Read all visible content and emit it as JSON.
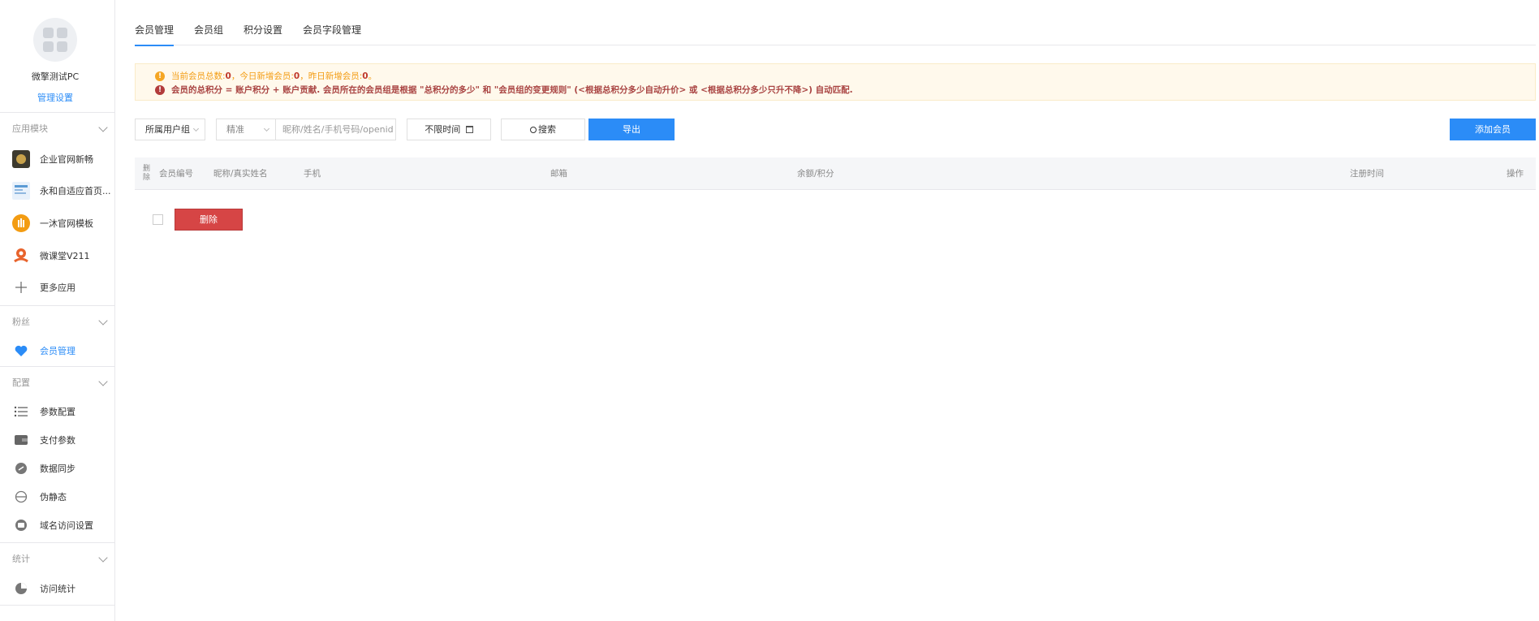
{
  "sidebar": {
    "app_name": "微擎测试PC",
    "manage_link": "管理设置",
    "groups": [
      {
        "title": "应用模块"
      },
      {
        "title": "粉丝"
      },
      {
        "title": "配置"
      },
      {
        "title": "统计"
      }
    ],
    "apps": [
      {
        "label": "企业官网新畅",
        "icon": "app-thumbnail-icon"
      },
      {
        "label": "永和自适应首页...",
        "icon": "app-thumbnail-icon"
      },
      {
        "label": "一沐官网模板",
        "icon": "app-thumbnail-icon"
      },
      {
        "label": "微课堂V211",
        "icon": "app-thumbnail-icon"
      },
      {
        "label": "更多应用",
        "icon": "plus-icon"
      }
    ],
    "fans": [
      {
        "label": "会员管理",
        "icon": "heart-icon",
        "active": true
      }
    ],
    "config": [
      {
        "label": "参数配置",
        "icon": "list-icon"
      },
      {
        "label": "支付参数",
        "icon": "wallet-icon"
      },
      {
        "label": "数据同步",
        "icon": "sync-icon"
      },
      {
        "label": "伪静态",
        "icon": "static-icon"
      },
      {
        "label": "域名访问设置",
        "icon": "domain-icon"
      }
    ],
    "stats": [
      {
        "label": "访问统计",
        "icon": "chart-icon"
      }
    ]
  },
  "tabs": [
    {
      "label": "会员管理",
      "active": true
    },
    {
      "label": "会员组",
      "active": false
    },
    {
      "label": "积分设置",
      "active": false
    },
    {
      "label": "会员字段管理",
      "active": false
    }
  ],
  "notice": {
    "line1_a": "当前会员总数:",
    "total": "0",
    "line1_b": "，今日新增会员:",
    "today": "0",
    "line1_c": "，昨日新增会员:",
    "yesterday": "0",
    "line1_d": "。",
    "line2": "会员的总积分 = 账户积分 + 账户贡献. 会员所在的会员组是根据 \"总积分的多少\" 和 \"会员组的变更规则\" (<根据总积分多少自动升价> 或 <根据总积分多少只升不降>) 自动匹配."
  },
  "toolbar": {
    "group_select": "所属用户组",
    "match_select": "精准",
    "search_placeholder": "昵称/姓名/手机号码/openid",
    "time_filter": "不限时间",
    "search_button": "搜索",
    "export_button": "导出",
    "add_button": "添加会员"
  },
  "table": {
    "delete_col": "删除",
    "columns": [
      "会员编号",
      "昵称/真实姓名",
      "手机",
      "邮箱",
      "余额/积分",
      "注册时间",
      "操作"
    ]
  },
  "actions": {
    "delete_button": "删除"
  },
  "colors": {
    "accent": "#2b8cf7",
    "danger": "#d64545",
    "warning_bg": "#fff9ec"
  }
}
